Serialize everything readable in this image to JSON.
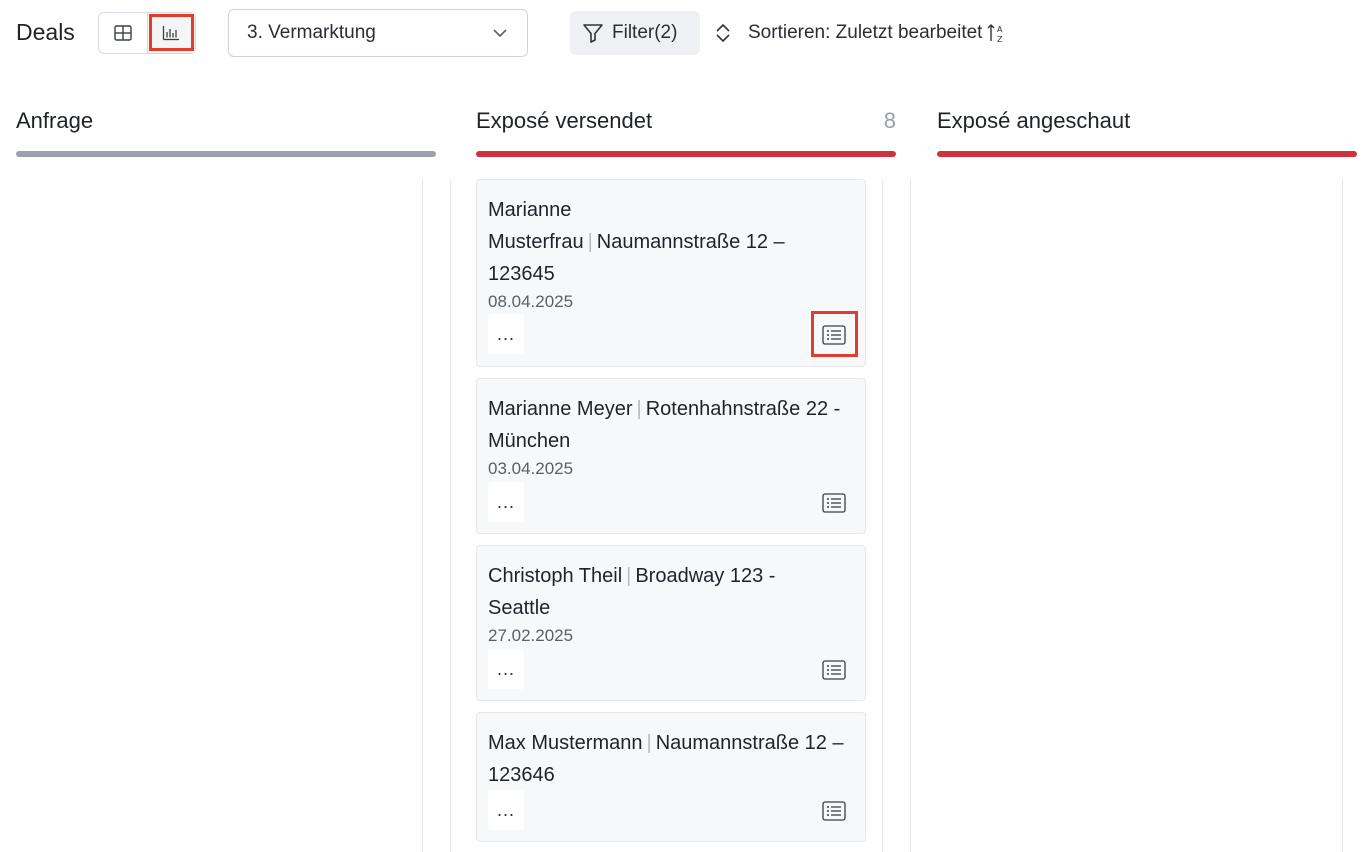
{
  "header": {
    "title": "Deals",
    "views": [
      {
        "name": "grid-view",
        "icon": "grid-icon"
      },
      {
        "name": "kanban-view",
        "icon": "bar-chart-icon",
        "active": true
      }
    ],
    "stage_select": {
      "value": "3. Vermarktung",
      "icon": "chevron-down-icon"
    },
    "filter": {
      "label": "Filter(2)",
      "icon": "funnel-icon"
    },
    "sort": {
      "label": "Sortieren: Zuletzt bearbeitet",
      "icon": "sort-updown-icon",
      "order_icon": "sort-az-icon"
    }
  },
  "columns": [
    {
      "title": "Anfrage",
      "count": "",
      "color": "#9ca1ad"
    },
    {
      "title": "Exposé versendet",
      "count": "8",
      "color": "#d0313f"
    },
    {
      "title": "Exposé angeschaut",
      "count": "",
      "color": "#d0313f"
    }
  ],
  "cards": [
    {
      "contact": "Marianne Musterfrau",
      "property": "Naumannstraße 12 – 123645",
      "date": "08.04.2025",
      "more": "...",
      "icon": "list-icon"
    },
    {
      "contact": "Marianne Meyer",
      "property": "Rotenhahnstraße 22 - München",
      "date": "03.04.2025",
      "more": "...",
      "icon": "list-icon"
    },
    {
      "contact": "Christoph Theil",
      "property": "Broadway 123 - Seattle",
      "date": "27.02.2025",
      "more": "...",
      "icon": "list-icon"
    },
    {
      "contact": "Max Mustermann",
      "property": "Naumannstraße 12 – 123646",
      "date": "",
      "more": "...",
      "icon": "list-icon"
    }
  ],
  "colors": {
    "accent_red": "#d0313f",
    "highlight": "#e23c2c",
    "neutral_bar": "#9ca1ad"
  }
}
